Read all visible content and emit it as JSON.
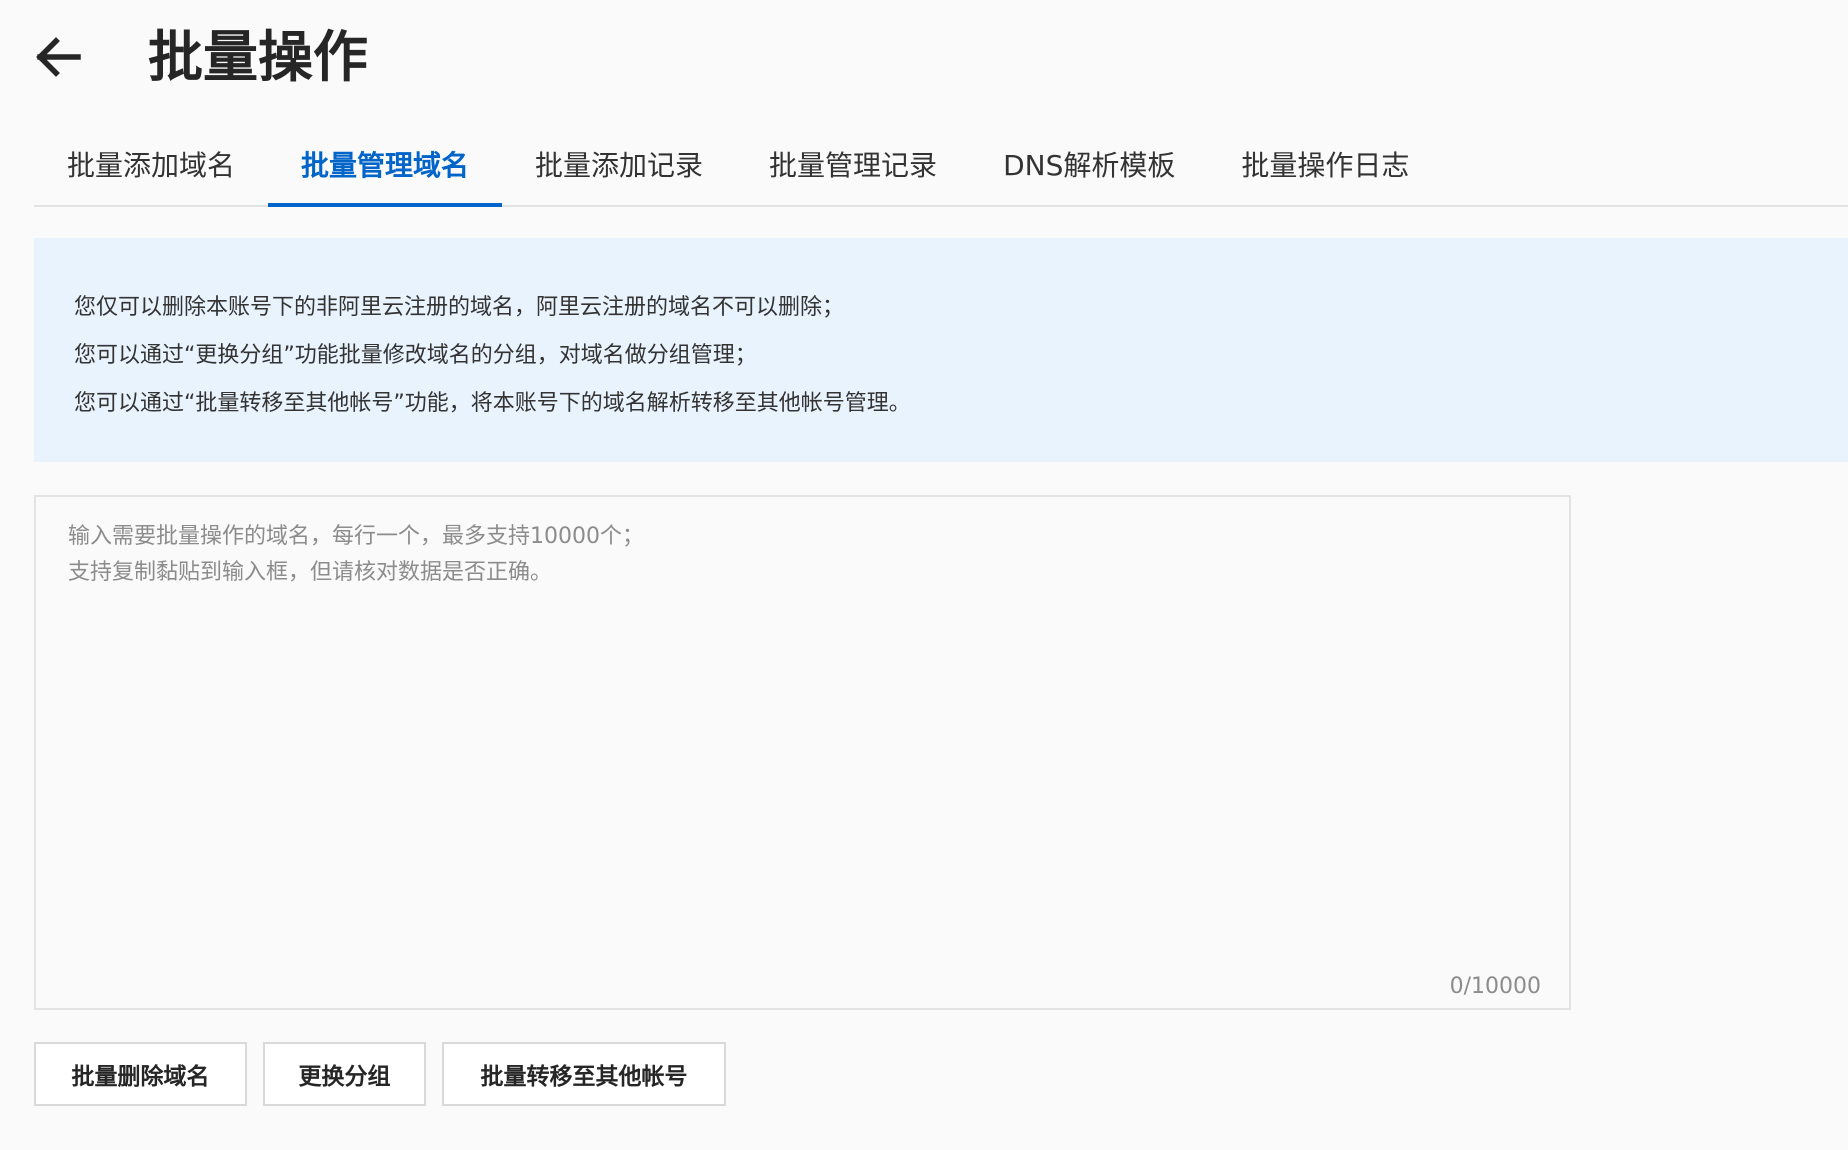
{
  "header": {
    "back_icon": "arrow-left-icon",
    "title": "批量操作"
  },
  "tabs": [
    {
      "label": "批量添加域名",
      "active": false
    },
    {
      "label": "批量管理域名",
      "active": true
    },
    {
      "label": "批量添加记录",
      "active": false
    },
    {
      "label": "批量管理记录",
      "active": false
    },
    {
      "label": "DNS解析模板",
      "active": false
    },
    {
      "label": "批量操作日志",
      "active": false
    }
  ],
  "notice": {
    "lines": [
      "您仅可以删除本账号下的非阿里云注册的域名，阿里云注册的域名不可以删除；",
      "您可以通过“更换分组”功能批量修改域名的分组，对域名做分组管理；",
      "您可以通过“批量转移至其他帐号”功能，将本账号下的域名解析转移至其他帐号管理。"
    ]
  },
  "domain_input": {
    "value": "",
    "placeholder": "输入需要批量操作的域名，每行一个，最多支持10000个；\n支持复制黏贴到输入框，但请核对数据是否正确。",
    "counter": "0/10000"
  },
  "actions": {
    "delete_label": "批量删除域名",
    "change_group_label": "更换分组",
    "transfer_label": "批量转移至其他帐号"
  },
  "colors": {
    "accent": "#0064c8",
    "notice_bg": "#e8f3fe",
    "border": "#e3e3e3",
    "page_bg": "#fafafa"
  }
}
